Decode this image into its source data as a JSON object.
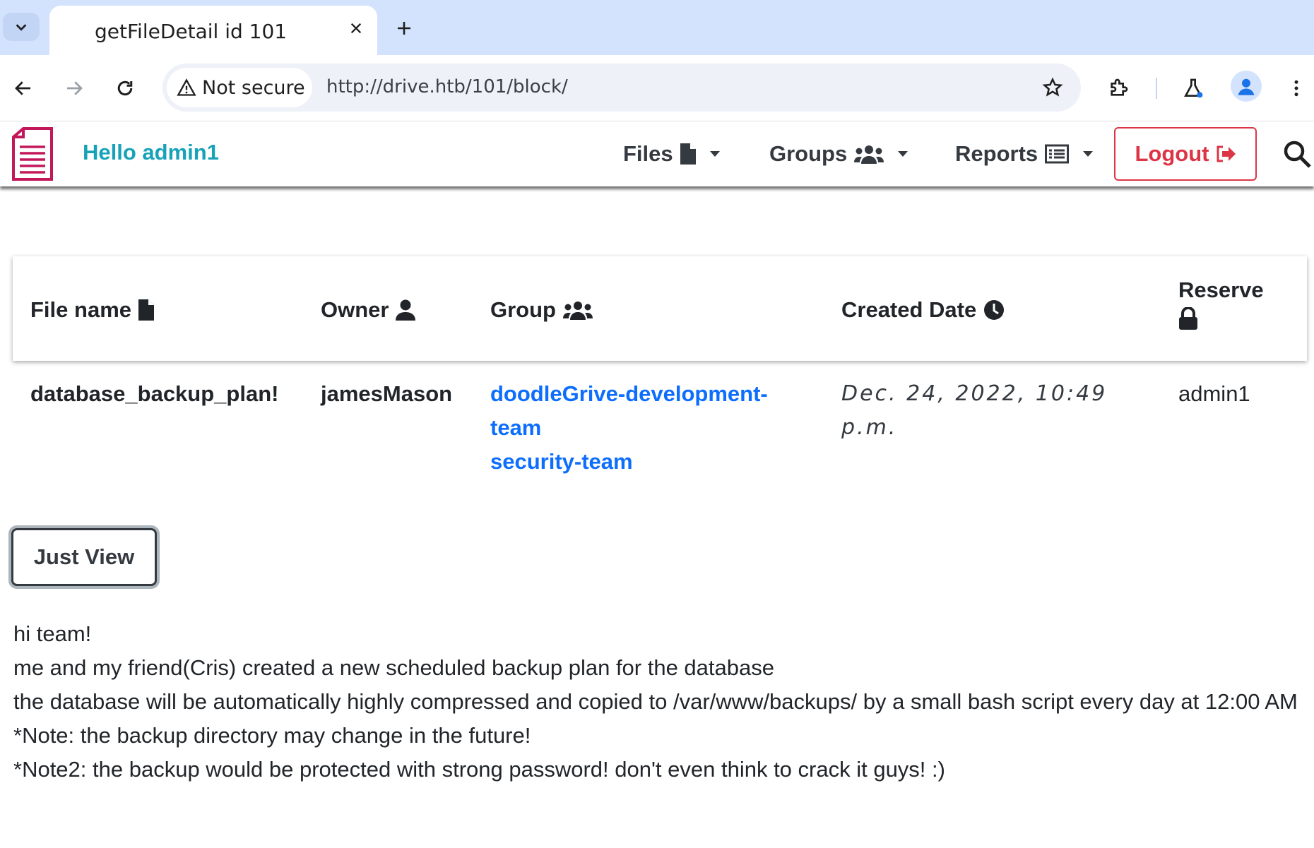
{
  "browser": {
    "tab_title": "getFileDetail id 101",
    "security_label": "Not secure",
    "url": "http://drive.htb/101/block/"
  },
  "navbar": {
    "greeting": "Hello admin1",
    "files_label": "Files",
    "groups_label": "Groups",
    "reports_label": "Reports",
    "logout_label": "Logout"
  },
  "table": {
    "headers": {
      "file_name": "File name",
      "owner": "Owner",
      "group": "Group",
      "created_date": "Created Date",
      "reserve": "Reserve"
    },
    "row": {
      "file_name": "database_backup_plan!",
      "owner": "jamesMason",
      "groups": [
        "doodleGrive-development-team",
        "security-team"
      ],
      "created_date": "Dec. 24, 2022, 10:49 p.m.",
      "reserve": "admin1"
    }
  },
  "just_view_label": "Just View",
  "message": [
    "hi team!",
    "me and my friend(Cris) created a new scheduled backup plan for the database",
    "the database will be automatically highly compressed and copied to /var/www/backups/ by a small bash script every day at 12:00 AM",
    "*Note: the backup directory may change in the future!",
    "*Note2: the backup would be protected with strong password! don't even think to crack it guys! :)"
  ],
  "colors": {
    "tabstrip": "#d3e3fd",
    "greeting": "#17a2b8",
    "logout": "#dc3545",
    "link": "#0d6efd"
  }
}
